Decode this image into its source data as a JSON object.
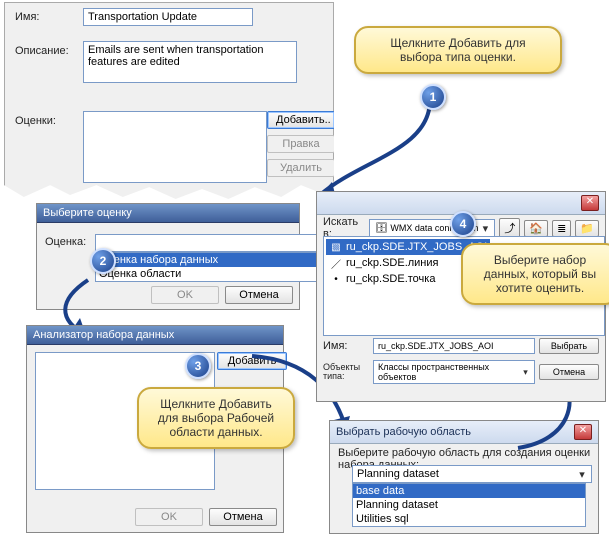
{
  "tornForm": {
    "nameLabel": "Имя:",
    "nameValue": "Transportation Update",
    "descLabel": "Описание:",
    "descValue": "Emails are sent when transportation features are edited",
    "evalLabel": "Оценки:",
    "addBtn": "Добавить..",
    "editBtn": "Правка",
    "deleteBtn": "Удалить"
  },
  "callouts": {
    "c1": "Щелкните Добавить для выбора типа оценки.",
    "c3": "Щелкните Добавить для выбора Рабочей области данных.",
    "c4": "Выберите набор данных, который вы хотите оценить."
  },
  "dlg1": {
    "title": "Выберите оценку",
    "label": "Оценка:",
    "opt1": "Оценка набора данных",
    "opt2": "Оценка области",
    "ok": "OK",
    "cancel": "Отмена"
  },
  "dlg2": {
    "title": "Анализатор набора данных",
    "addBtn": "Добавить",
    "ok": "OK",
    "cancel": "Отмена"
  },
  "dlg3": {
    "title": "Выбрать рабочую область",
    "instr": "Выберите рабочую область для создания оценки набора данных:",
    "selected": "Planning dataset",
    "o1": "base data",
    "o2": "Planning dataset",
    "o3": "Utilities sql"
  },
  "dlg4": {
    "lookInLabel": "Искать в:",
    "lookInValue": "WMX data connection",
    "item1": "ru_ckp.SDE.JTX_JOBS_AOI",
    "item2": "ru_ckp.SDE.линия",
    "item3": "ru_ckp.SDE.точка",
    "nameLabel": "Имя:",
    "nameValue": "ru_ckp.SDE.JTX_JOBS_AOI",
    "typeLabel": "Объекты типа:",
    "typeValue": "Классы пространственных объектов",
    "selectBtn": "Выбрать",
    "cancelBtn": "Отмена"
  },
  "nums": {
    "n1": "1",
    "n2": "2",
    "n3": "3",
    "n4": "4"
  }
}
